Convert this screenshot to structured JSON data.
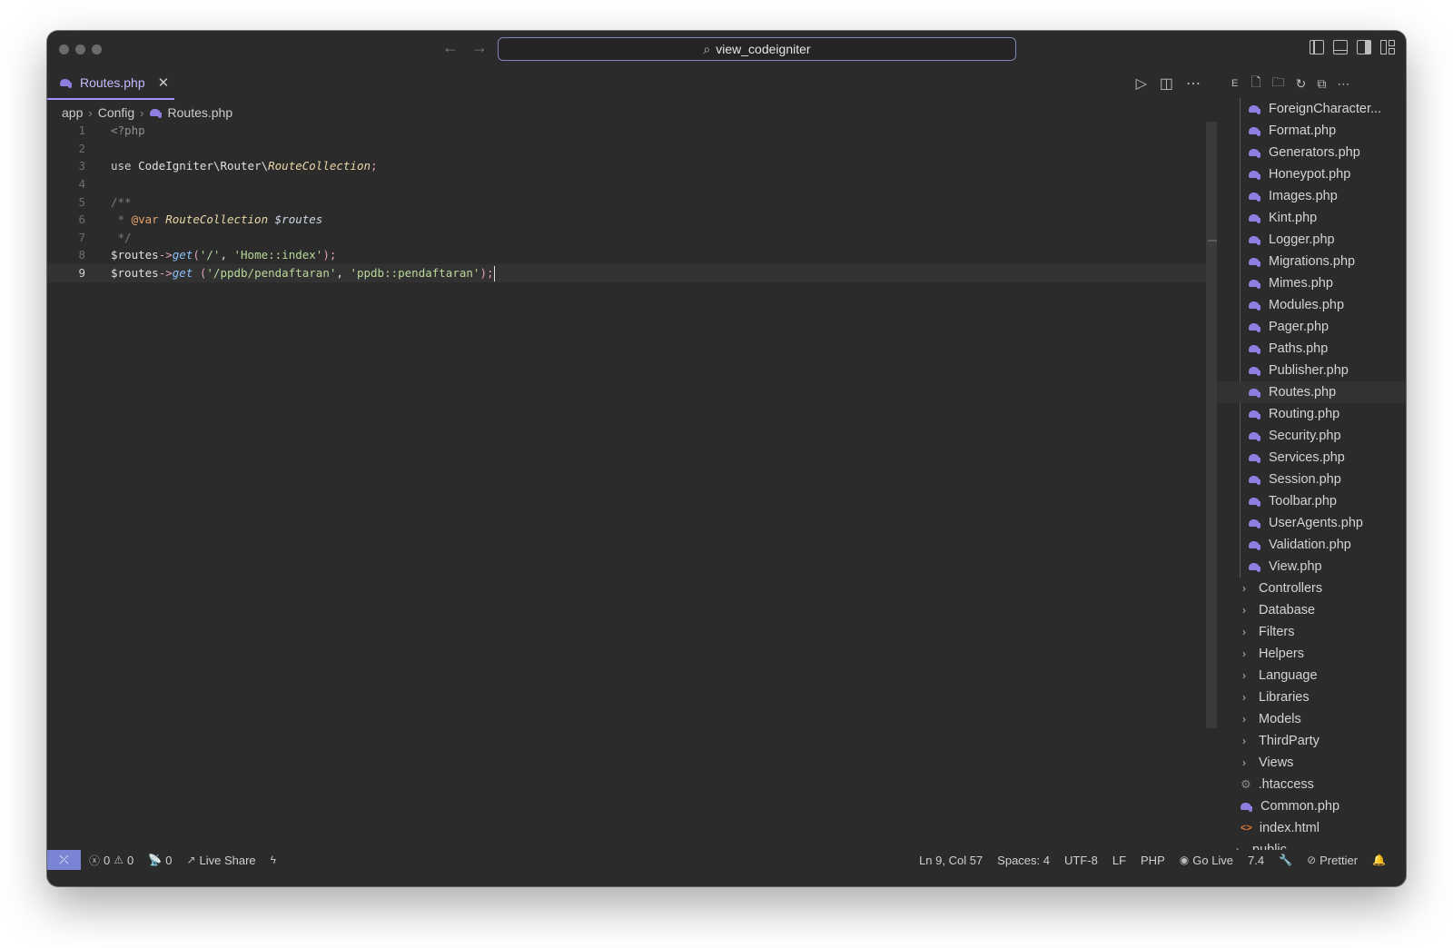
{
  "window": {
    "search_text": "view_codeigniter"
  },
  "tab": {
    "label": "Routes.php"
  },
  "breadcrumb": {
    "items": [
      "app",
      "Config",
      "Routes.php"
    ]
  },
  "editor": {
    "line_numbers": [
      "1",
      "2",
      "3",
      "4",
      "5",
      "6",
      "7",
      "8",
      "9"
    ],
    "line1": {
      "tag": "<?php"
    },
    "line3": {
      "kw": "use",
      "ns1": "CodeIgniter",
      "bs1": "\\",
      "ns2": "Router",
      "bs2": "\\",
      "cls": "RouteCollection",
      "semi": ";"
    },
    "line5": {
      "com": "/**"
    },
    "line6": {
      "star": " * ",
      "anno": "@var",
      "cls": "RouteCollection",
      "var": "$routes"
    },
    "line7": {
      "com": " */"
    },
    "line8": {
      "var": "$routes",
      "arrow": "->",
      "fn": "get",
      "p1": "(",
      "s1": "'/'",
      "comma": ", ",
      "s2": "'Home::index'",
      "p2": ");"
    },
    "line9": {
      "var": "$routes",
      "arrow": "->",
      "fn": "get",
      "sp": " ",
      "p1": "(",
      "s1": "'/ppdb/pendaftaran'",
      "comma": ", ",
      "s2": "'ppdb::pendaftaran'",
      "p2": ");"
    }
  },
  "explorer": {
    "head_label": "E",
    "files": [
      "ForeignCharacter...",
      "Format.php",
      "Generators.php",
      "Honeypot.php",
      "Images.php",
      "Kint.php",
      "Logger.php",
      "Migrations.php",
      "Mimes.php",
      "Modules.php",
      "Pager.php",
      "Paths.php",
      "Publisher.php",
      "Routes.php",
      "Routing.php",
      "Security.php",
      "Services.php",
      "Session.php",
      "Toolbar.php",
      "UserAgents.php",
      "Validation.php",
      "View.php"
    ],
    "folders": [
      "Controllers",
      "Database",
      "Filters",
      "Helpers",
      "Language",
      "Libraries",
      "Models",
      "ThirdParty",
      "Views"
    ],
    "app_files": [
      ".htaccess",
      "Common.php",
      "index.html"
    ],
    "root_folder": "public"
  },
  "statusbar": {
    "errors": "0",
    "warnings": "0",
    "ports": "0",
    "live_share": "Live Share",
    "position": "Ln 9, Col 57",
    "spaces": "Spaces: 4",
    "encoding": "UTF-8",
    "eol": "LF",
    "language": "PHP",
    "go_live": "Go Live",
    "php_version": "7.4",
    "prettier": "Prettier"
  },
  "colors": {
    "accent": "#a590ff",
    "remote_bg": "#7b83d4",
    "editor_bg": "#2b2b2b"
  }
}
